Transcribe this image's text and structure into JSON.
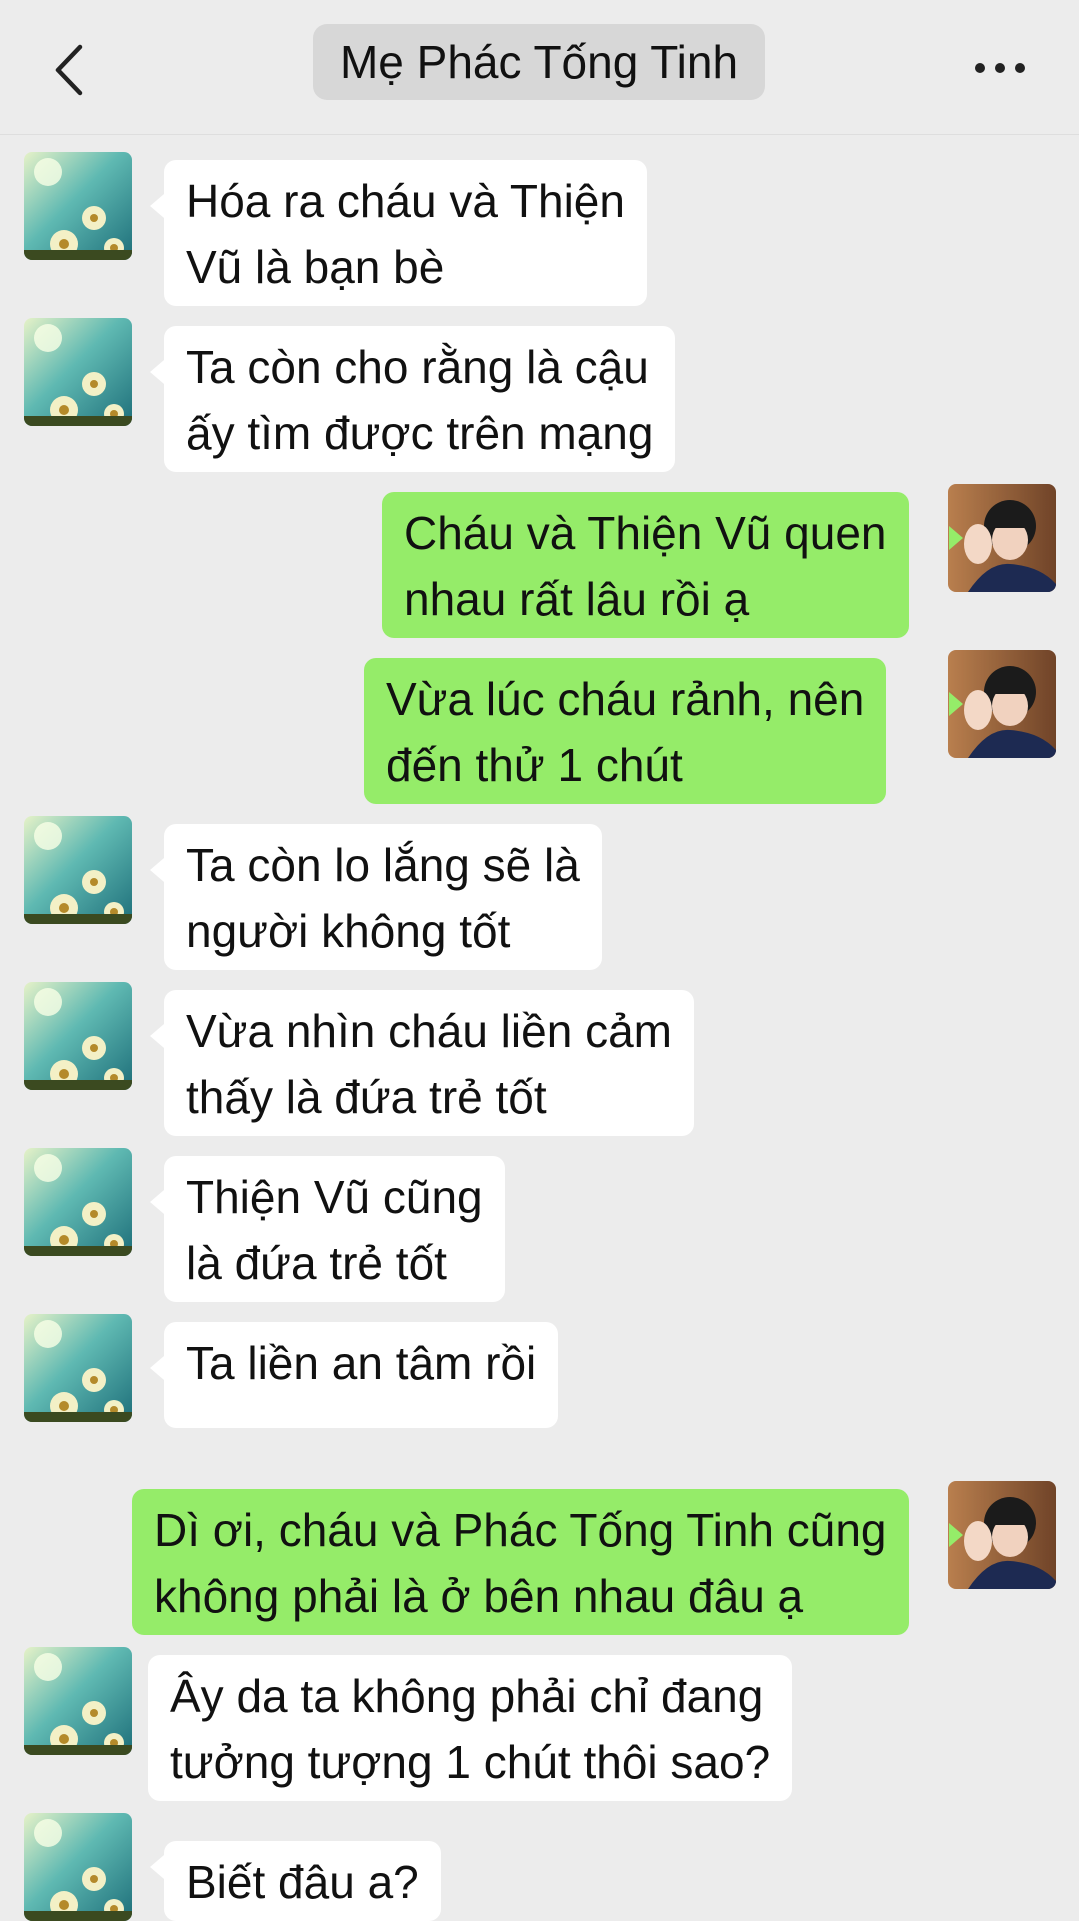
{
  "header": {
    "title": "Mẹ Phác Tống Tinh",
    "back_icon": "chevron-left-icon",
    "more_icon": "more-horizontal-icon"
  },
  "colors": {
    "background": "#ececec",
    "incoming_bubble": "#ffffff",
    "outgoing_bubble": "#95ec69",
    "title_pill": "#d7d7d7"
  },
  "messages": [
    {
      "side": "in",
      "lines": [
        "Hóa ra cháu và Thiện",
        "Vũ là bạn bè"
      ]
    },
    {
      "side": "in",
      "lines": [
        "Ta còn cho rằng là cậu",
        "ấy tìm được trên mạng"
      ]
    },
    {
      "side": "out",
      "lines": [
        "Cháu và Thiện Vũ quen",
        "nhau rất lâu rồi ạ"
      ]
    },
    {
      "side": "out",
      "lines": [
        "Vừa lúc cháu rảnh, nên",
        "đến thử 1 chút"
      ]
    },
    {
      "side": "in",
      "lines": [
        "Ta còn lo lắng sẽ là",
        "người không tốt"
      ]
    },
    {
      "side": "in",
      "lines": [
        "Vừa nhìn cháu liền cảm",
        "thấy là đứa trẻ tốt"
      ]
    },
    {
      "side": "in",
      "lines": [
        "Thiện Vũ cũng",
        "là đứa trẻ tốt"
      ]
    },
    {
      "side": "in",
      "lines": [
        "Ta liền an tâm rồi"
      ]
    },
    {
      "side": "out",
      "lines": [
        "Dì ơi, cháu và Phác Tống Tinh cũng",
        "không phải là ở bên nhau đâu ạ"
      ]
    },
    {
      "side": "in",
      "lines": [
        "Ây da ta không phải chỉ đang",
        "tưởng tượng 1 chút thôi sao?"
      ]
    },
    {
      "side": "in",
      "lines": [
        "Biết đâu a?"
      ]
    }
  ]
}
